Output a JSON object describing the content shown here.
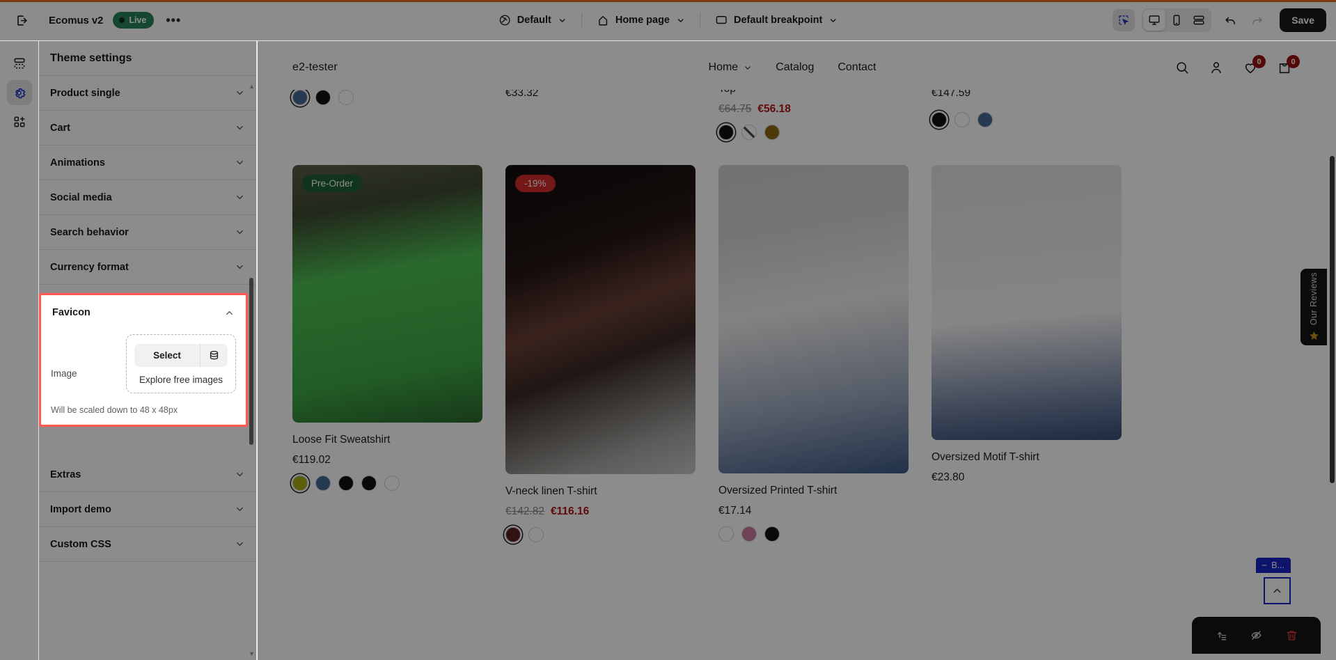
{
  "topbar": {
    "exit_icon": "exit-icon",
    "store_name": "Ecomus v2",
    "live_label": "Live",
    "more_label": "•••",
    "theme_select": "Default",
    "page_select": "Home page",
    "breakpoint_select": "Default breakpoint",
    "save_label": "Save",
    "icons": {
      "globe": "globe-icon",
      "home": "home-icon",
      "monitor": "monitor-icon",
      "select_tool": "select-tool-icon",
      "desktop": "desktop-icon",
      "mobile": "mobile-icon",
      "fullwidth": "fullwidth-icon",
      "undo": "undo-icon",
      "redo": "redo-icon"
    }
  },
  "rail": {
    "items": [
      {
        "name": "sections-icon",
        "label": "Sections"
      },
      {
        "name": "gear-icon",
        "label": "Theme settings",
        "active": true
      },
      {
        "name": "apps-add-icon",
        "label": "Apps"
      }
    ]
  },
  "panel": {
    "title": "Theme settings",
    "sections": [
      {
        "label": "Product single"
      },
      {
        "label": "Cart"
      },
      {
        "label": "Animations"
      },
      {
        "label": "Social media"
      },
      {
        "label": "Search behavior"
      },
      {
        "label": "Currency format"
      }
    ],
    "sections_after": [
      {
        "label": "Extras"
      },
      {
        "label": "Import demo"
      },
      {
        "label": "Custom CSS"
      }
    ],
    "favicon": {
      "title": "Favicon",
      "image_label": "Image",
      "select_label": "Select",
      "library_icon": "library-stack-icon",
      "explore_label": "Explore free images",
      "help_text": "Will be scaled down to 48 x 48px",
      "collapse_icon": "chevron-up-icon",
      "highlight_color": "#ff5a4f"
    }
  },
  "preview": {
    "store_logo": "e2-tester",
    "nav": [
      {
        "label": "Home",
        "has_dropdown": true
      },
      {
        "label": "Catalog",
        "has_dropdown": false
      },
      {
        "label": "Contact",
        "has_dropdown": false
      }
    ],
    "actions": [
      {
        "name": "search-icon",
        "badge": null
      },
      {
        "name": "account-icon",
        "badge": null
      },
      {
        "name": "wishlist-heart-icon",
        "badge": "0"
      },
      {
        "name": "cart-bag-icon",
        "badge": "0"
      }
    ],
    "top_row_partial": [
      {
        "price": "",
        "swatches": [
          "#3a5b8c",
          "#111111",
          "#ffffff"
        ]
      },
      {
        "price": "€33.32"
      },
      {
        "title": "Top",
        "old_price": "€64.75",
        "new_price": "€56.18",
        "swatches": [
          "#111111",
          "stripe",
          "#8a6a14"
        ]
      },
      {
        "price": "€147.59",
        "swatches": [
          "#111111",
          "#ffffff",
          "#4a6a94"
        ]
      }
    ],
    "products": [
      {
        "title": "Loose Fit Sweatshirt",
        "badge": {
          "text": "Pre-Order",
          "style": "green"
        },
        "price": "€119.02",
        "old_price": null,
        "swatches": [
          "#a8ab17",
          "#4a6a94",
          "#111111",
          "#111111",
          "#ffffff"
        ],
        "image": "img-green"
      },
      {
        "title": "V-neck linen T-shirt",
        "badge": {
          "text": "-19%",
          "style": "red"
        },
        "price": null,
        "old_price": "€142.82",
        "new_price": "€116.16",
        "swatches": [
          "#5a1f1f",
          "#ffffff"
        ],
        "image": "img-dark"
      },
      {
        "title": "Oversized Printed T-shirt",
        "badge": null,
        "price": "€17.14",
        "old_price": null,
        "swatches": [
          "#ffffff",
          "#c97aa0",
          "#111111"
        ],
        "image": "img-white"
      },
      {
        "title": "Oversized Motif T-shirt",
        "badge": null,
        "price": "€23.80",
        "old_price": null,
        "swatches": [],
        "image": "img-tee"
      }
    ],
    "reviews_tab": {
      "label": "Our Reviews",
      "star_icon": "star-icon"
    },
    "back_to_top": {
      "label": "B...",
      "icon": "chevron-up-icon",
      "accent": "#1a26c4"
    },
    "float_toolbar": [
      {
        "name": "move-up-icon"
      },
      {
        "name": "hide-eye-slash-icon"
      },
      {
        "name": "delete-trash-icon"
      }
    ]
  }
}
